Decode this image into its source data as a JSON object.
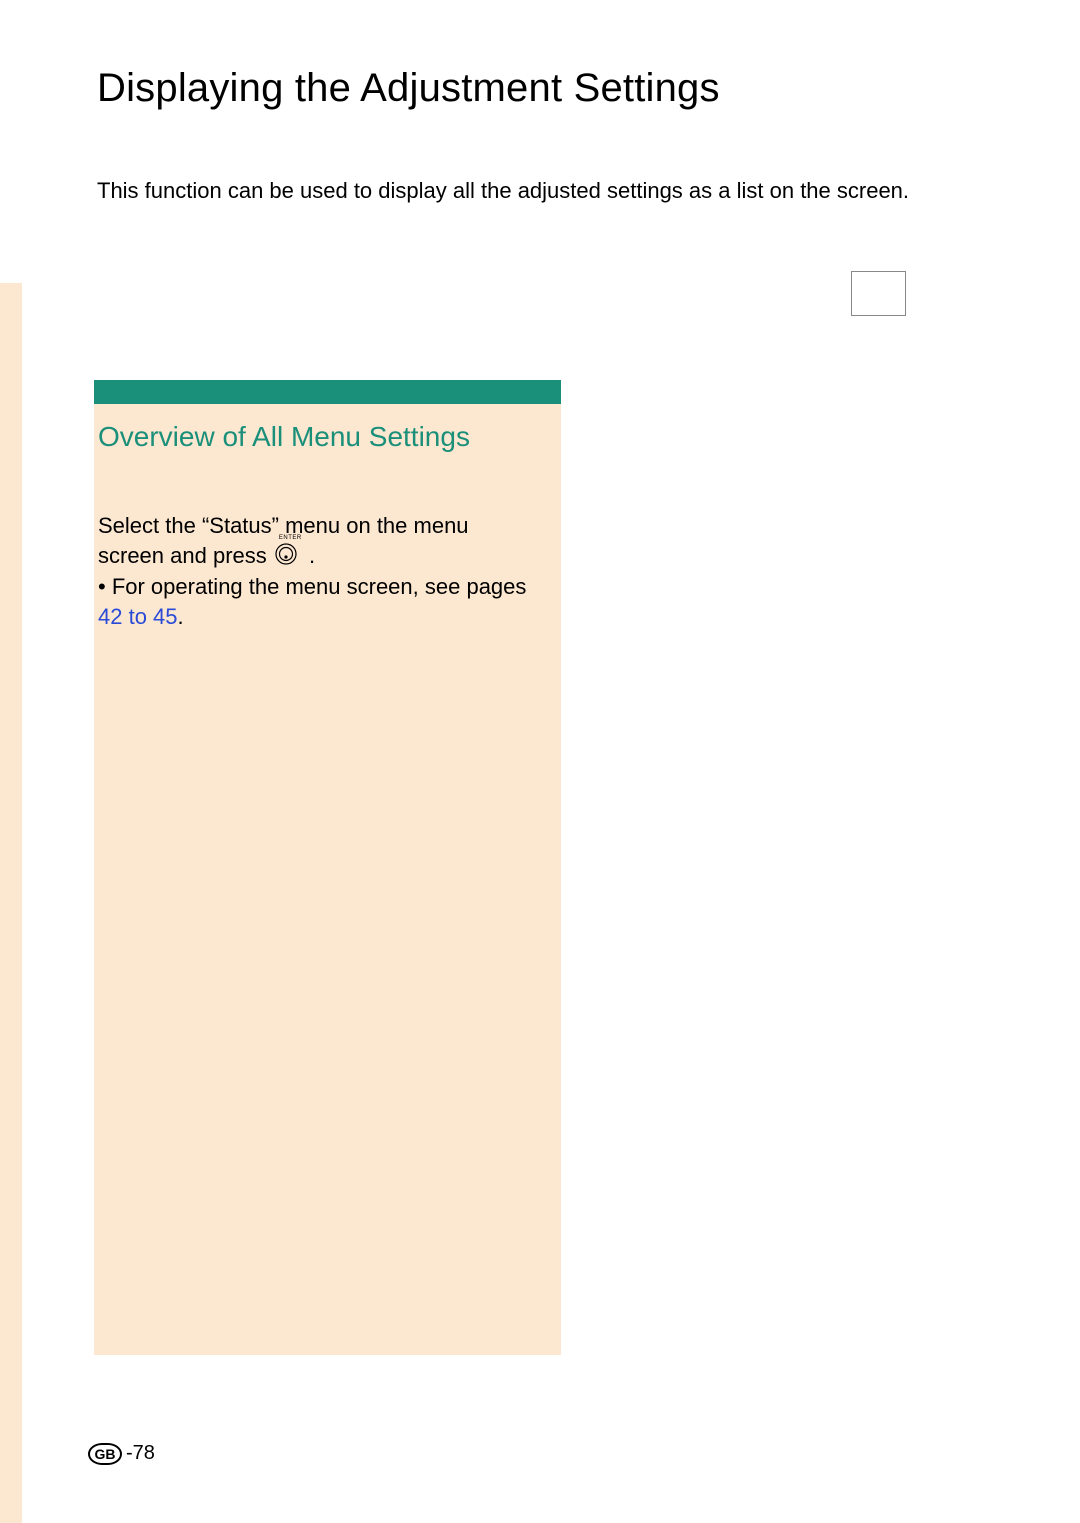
{
  "header": {
    "title": "Displaying the Adjustment Settings"
  },
  "intro": {
    "text": "This function can be used to display all the adjusted settings as a list on the screen."
  },
  "section": {
    "subheading": "Overview of All Menu Settings",
    "instruction_part1": "Select the “Status” menu on the menu screen and press ",
    "instruction_part2": ".",
    "enter_icon_label": "ENTER",
    "note_prefix": "• For operating the menu screen, see pages ",
    "note_link": "42 to 45",
    "note_suffix": "."
  },
  "footer": {
    "region": "GB",
    "page_number": "-78"
  }
}
